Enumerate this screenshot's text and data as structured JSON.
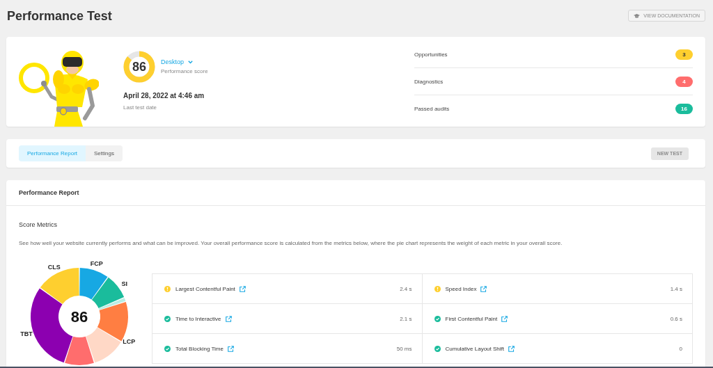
{
  "header": {
    "title": "Performance Test",
    "documentation_button": "VIEW DOCUMENTATION"
  },
  "summary": {
    "score": {
      "value": "86",
      "level": 0.86
    },
    "device": "Desktop",
    "score_label": "Performance score",
    "test_date": "April 28, 2022 at 4:46 am",
    "date_label": "Last test date",
    "audits": [
      {
        "label": "Opportunities",
        "count": "3",
        "color": "#fecf2f"
      },
      {
        "label": "Diagnostics",
        "count": "4",
        "color": "#ff6d6d"
      },
      {
        "label": "Passed audits",
        "count": "16",
        "color": "#1abc9c"
      }
    ]
  },
  "tabs": [
    {
      "label": "Performance Report",
      "selected": true
    },
    {
      "label": "Settings",
      "selected": false
    }
  ],
  "new_test_button": {
    "label": "NEW TEST",
    "disabled": true
  },
  "report": {
    "title": "Performance Report",
    "section_title": "Score Metrics",
    "description": "See how well your website currently performs and what can be improved. Your overall performance score is calculated from the metrics below, where the pie chart represents the weight of each metric in your overall score.",
    "donut": {
      "center_value": "86",
      "segments": [
        {
          "label": "FCP",
          "color": "#17a8e3"
        },
        {
          "label": "SI",
          "color": "#1abc9c"
        },
        {
          "color": "#b9ede3"
        },
        {
          "label": "LCP",
          "color": "#ff7e42"
        },
        {
          "color": "#ffd8c6"
        },
        {
          "color": "#ff6d6d"
        },
        {
          "label": "TBT",
          "color": "#8c00b0"
        },
        {
          "label": "CLS",
          "color": "#fecf2f"
        }
      ]
    },
    "metrics": [
      {
        "name": "Largest Contentful Paint",
        "kind": "warning",
        "value": "2.4 s"
      },
      {
        "name": "Speed Index",
        "kind": "warning",
        "value": "1.4 s"
      },
      {
        "name": "Time to Interactive",
        "kind": "passed",
        "value": "2.1 s"
      },
      {
        "name": "First Contentful Paint",
        "kind": "passed",
        "value": "0.6 s"
      },
      {
        "name": "Total Blocking Time",
        "kind": "passed",
        "value": "50 ms"
      },
      {
        "name": "Cumulative Layout Shift",
        "kind": "passed",
        "value": "0"
      }
    ]
  }
}
